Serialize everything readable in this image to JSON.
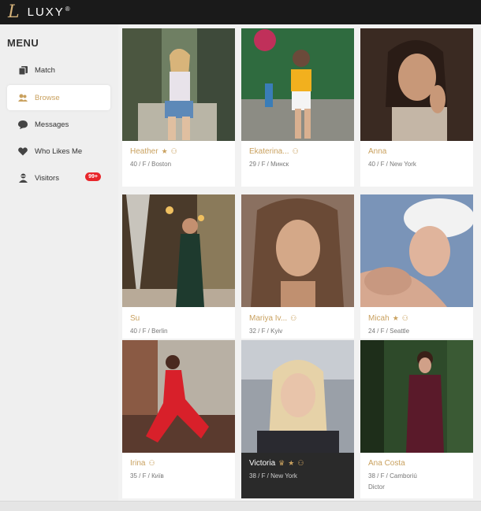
{
  "brand": {
    "mark": "L",
    "name": "LUXY",
    "reg": "®"
  },
  "sidebar": {
    "title": "MENU",
    "items": [
      {
        "label": "Match",
        "icon": "match-icon"
      },
      {
        "label": "Browse",
        "icon": "browse-icon",
        "active": true
      },
      {
        "label": "Messages",
        "icon": "messages-icon"
      },
      {
        "label": "Who Likes Me",
        "icon": "heart-icon"
      },
      {
        "label": "Visitors",
        "icon": "visitors-icon",
        "badge": "99+"
      }
    ]
  },
  "profiles": [
    {
      "name": "Heather",
      "details": "40 / F / Boston",
      "star": true,
      "verified": true
    },
    {
      "name": "Ekaterina...",
      "details": "29 / F / Минск",
      "verified": true
    },
    {
      "name": "Anna",
      "details": "40 / F / New York"
    },
    {
      "name": "Su",
      "details": "40 / F / Berlin"
    },
    {
      "name": "Mariya Iv...",
      "details": "32 / F / Kyiv",
      "verified": true
    },
    {
      "name": "Micah",
      "details": "24 / F / Seattle",
      "star": true,
      "verified": true
    },
    {
      "name": "Irina",
      "details": "35 / F / Київ",
      "verified": true
    },
    {
      "name": "Victoria",
      "details": "38 / F / New York",
      "crown": true,
      "star": true,
      "verified": true,
      "dark": true
    },
    {
      "name": "Ana Costa",
      "details": "38 / F / Camboriú",
      "extra": "Dictor"
    }
  ],
  "colors": {
    "accent": "#c9a15f",
    "topbar": "#1a1a1a",
    "badge": "#e8262b"
  },
  "glyphs": {
    "star": "★",
    "crown": "♛",
    "verified": "⚇"
  }
}
